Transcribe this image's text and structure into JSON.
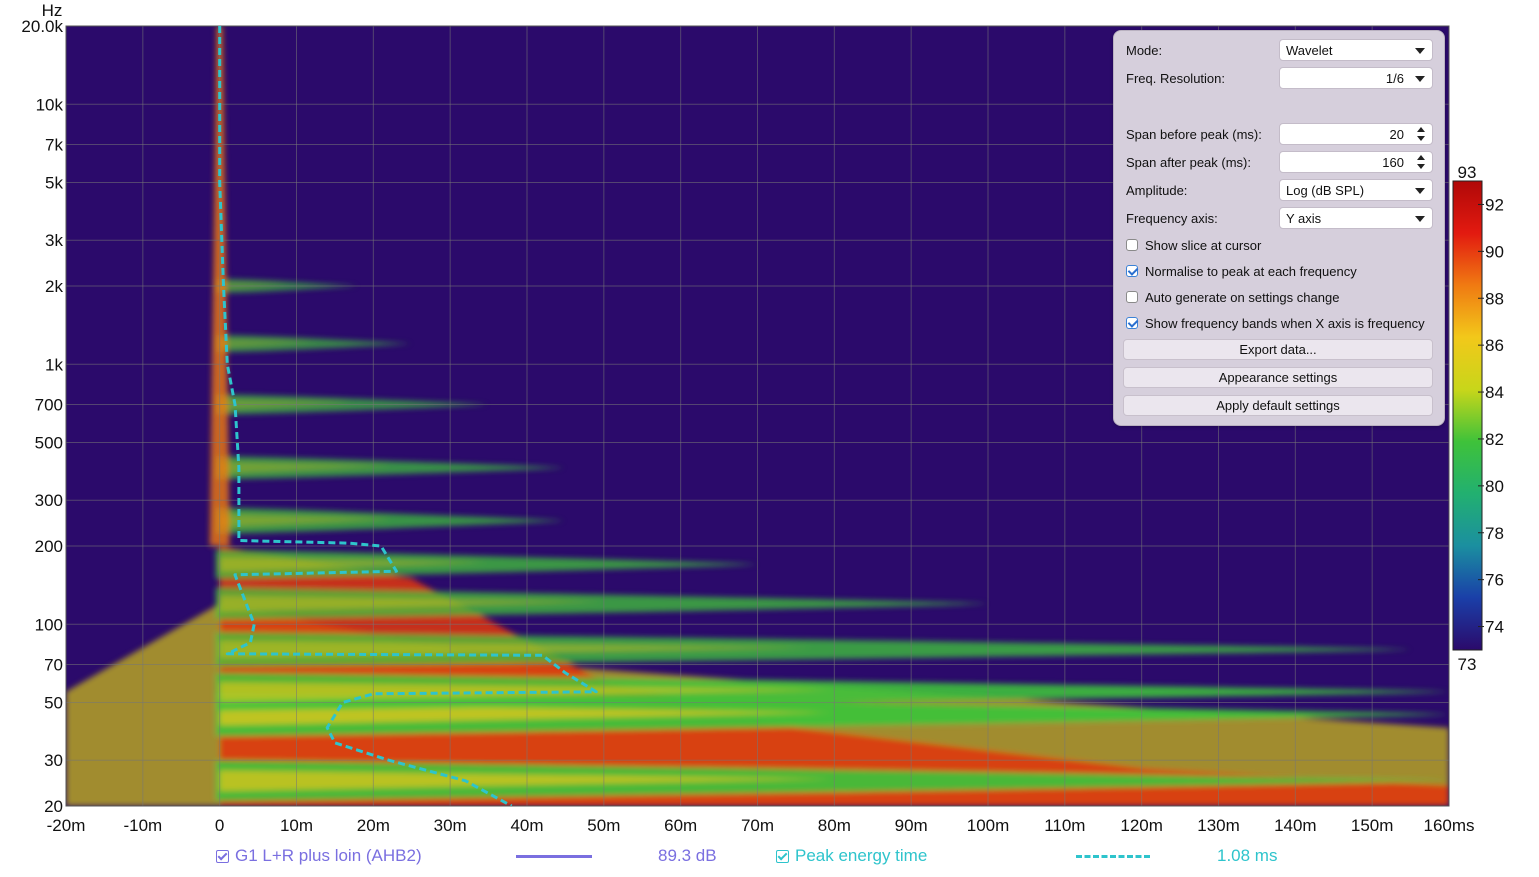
{
  "chart_data": {
    "type": "heatmap",
    "title": "",
    "xlabel": "",
    "ylabel": "Hz",
    "x_unit": "ms",
    "xlim": [
      -20,
      160
    ],
    "ylim": [
      20,
      20000
    ],
    "y_scale": "log",
    "x_ticks": [
      "-20m",
      "-10m",
      "0",
      "10m",
      "20m",
      "30m",
      "40m",
      "50m",
      "60m",
      "70m",
      "80m",
      "90m",
      "100m",
      "110m",
      "120m",
      "130m",
      "140m",
      "150m",
      "160ms"
    ],
    "x_tick_values": [
      -20,
      -10,
      0,
      10,
      20,
      30,
      40,
      50,
      60,
      70,
      80,
      90,
      100,
      110,
      120,
      130,
      140,
      150,
      160
    ],
    "y_ticks": [
      "20.0k",
      "10k",
      "7k",
      "5k",
      "3k",
      "2k",
      "1k",
      "700",
      "500",
      "300",
      "200",
      "100",
      "70",
      "50",
      "30",
      "20"
    ],
    "y_tick_values": [
      20000,
      10000,
      7000,
      5000,
      3000,
      2000,
      1000,
      700,
      500,
      300,
      200,
      100,
      70,
      50,
      30,
      20
    ],
    "colorbar": {
      "min": 73,
      "max": 93,
      "top_label": "93",
      "bottom_label": "73",
      "ticks": [
        92,
        90,
        88,
        86,
        84,
        82,
        80,
        78,
        76,
        74
      ],
      "colors": [
        "#2b0a6b",
        "#1a3fa8",
        "#1b8fa0",
        "#22b070",
        "#3fc23a",
        "#c8d61a",
        "#f2c81a",
        "#f07a12",
        "#e21a10",
        "#b00808"
      ]
    },
    "ridges": [
      {
        "freq": 45,
        "end_ms": 160,
        "strength": 1.0
      },
      {
        "freq": 25,
        "end_ms": 160,
        "strength": 0.95
      },
      {
        "freq": 55,
        "end_ms": 160,
        "strength": 0.85
      },
      {
        "freq": 80,
        "end_ms": 155,
        "strength": 0.6
      },
      {
        "freq": 120,
        "end_ms": 100,
        "strength": 0.55
      },
      {
        "freq": 170,
        "end_ms": 70,
        "strength": 0.55
      },
      {
        "freq": 250,
        "end_ms": 45,
        "strength": 0.5
      },
      {
        "freq": 400,
        "end_ms": 45,
        "strength": 0.45
      },
      {
        "freq": 700,
        "end_ms": 35,
        "strength": 0.4
      },
      {
        "freq": 1200,
        "end_ms": 25,
        "strength": 0.35
      },
      {
        "freq": 2000,
        "end_ms": 18,
        "strength": 0.3
      }
    ],
    "peak_energy_time": [
      {
        "f": 20000,
        "t": 0.0
      },
      {
        "f": 5000,
        "t": 0.0
      },
      {
        "f": 2000,
        "t": 0.5
      },
      {
        "f": 1000,
        "t": 1.0
      },
      {
        "f": 700,
        "t": 2.0
      },
      {
        "f": 400,
        "t": 2.5
      },
      {
        "f": 210,
        "t": 2.5
      },
      {
        "f": 205,
        "t": 17.0
      },
      {
        "f": 200,
        "t": 21.0
      },
      {
        "f": 160,
        "t": 23.0
      },
      {
        "f": 155,
        "t": 2.0
      },
      {
        "f": 130,
        "t": 3.0
      },
      {
        "f": 100,
        "t": 4.5
      },
      {
        "f": 85,
        "t": 4.0
      },
      {
        "f": 77,
        "t": 1.0
      },
      {
        "f": 76,
        "t": 42.0
      },
      {
        "f": 65,
        "t": 45.0
      },
      {
        "f": 55,
        "t": 49.0
      },
      {
        "f": 54,
        "t": 20.0
      },
      {
        "f": 50,
        "t": 16.0
      },
      {
        "f": 40,
        "t": 14.0
      },
      {
        "f": 35,
        "t": 15.0
      },
      {
        "f": 30,
        "t": 22.0
      },
      {
        "f": 25,
        "t": 32.0
      },
      {
        "f": 20,
        "t": 38.0
      }
    ]
  },
  "panel": {
    "mode_label": "Mode:",
    "mode_value": "Wavelet",
    "freqres_label": "Freq. Resolution:",
    "freqres_value": "1/6",
    "span_before_label": "Span before peak (ms):",
    "span_before_value": "20",
    "span_after_label": "Span after peak (ms):",
    "span_after_value": "160",
    "amplitude_label": "Amplitude:",
    "amplitude_value": "Log (dB SPL)",
    "freqaxis_label": "Frequency axis:",
    "freqaxis_value": "Y axis",
    "show_slice": "Show slice at cursor",
    "normalise": "Normalise to peak at each frequency",
    "auto_generate": "Auto generate on settings change",
    "show_bands": "Show frequency bands when X axis is frequency",
    "export_btn": "Export data...",
    "appearance_btn": "Appearance settings",
    "defaults_btn": "Apply default settings"
  },
  "legend": {
    "series1_name": "G1 L+R plus loin (AHB2)",
    "series1_value": "89.3 dB",
    "series1_color": "#7a6fe0",
    "series2_name": "Peak energy time",
    "series2_value": "1.08 ms",
    "series2_color": "#2ec4cc"
  }
}
